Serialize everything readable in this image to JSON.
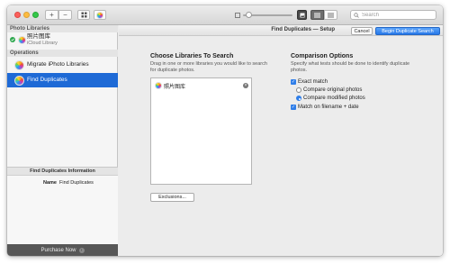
{
  "toolbar": {
    "add_symbol": "+",
    "remove_symbol": "−",
    "search_placeholder": "Search"
  },
  "sidebar": {
    "photo_libraries_header": "Photo Libraries",
    "library_name": "照片图库",
    "library_location": "iCloud Library",
    "operations_header": "Operations",
    "operations": [
      {
        "label": "Migrate iPhoto Libraries"
      },
      {
        "label": "Find Duplicates"
      }
    ],
    "info_title": "Find Duplicates Information",
    "info_name_key": "Name",
    "info_name_value": "Find Duplicates",
    "purchase_label": "Purchase Now"
  },
  "main": {
    "title": "Find Duplicates — Setup",
    "cancel_label": "Cancel",
    "begin_label": "Begin Duplicate Search",
    "choose": {
      "title": "Choose Libraries To Search",
      "description": "Drag in one or more libraries you would like to search for duplicate photos.",
      "libraries": [
        {
          "name": "照片图库"
        }
      ],
      "exclusions_label": "Exclusions..."
    },
    "comparison": {
      "title": "Comparison Options",
      "description": "Specify what tests should be done to identify duplicate photos.",
      "exact_match": "Exact match",
      "compare_original": "Compare original photos",
      "compare_modified": "Compare modified photos",
      "match_filename": "Match on filename + date"
    }
  }
}
